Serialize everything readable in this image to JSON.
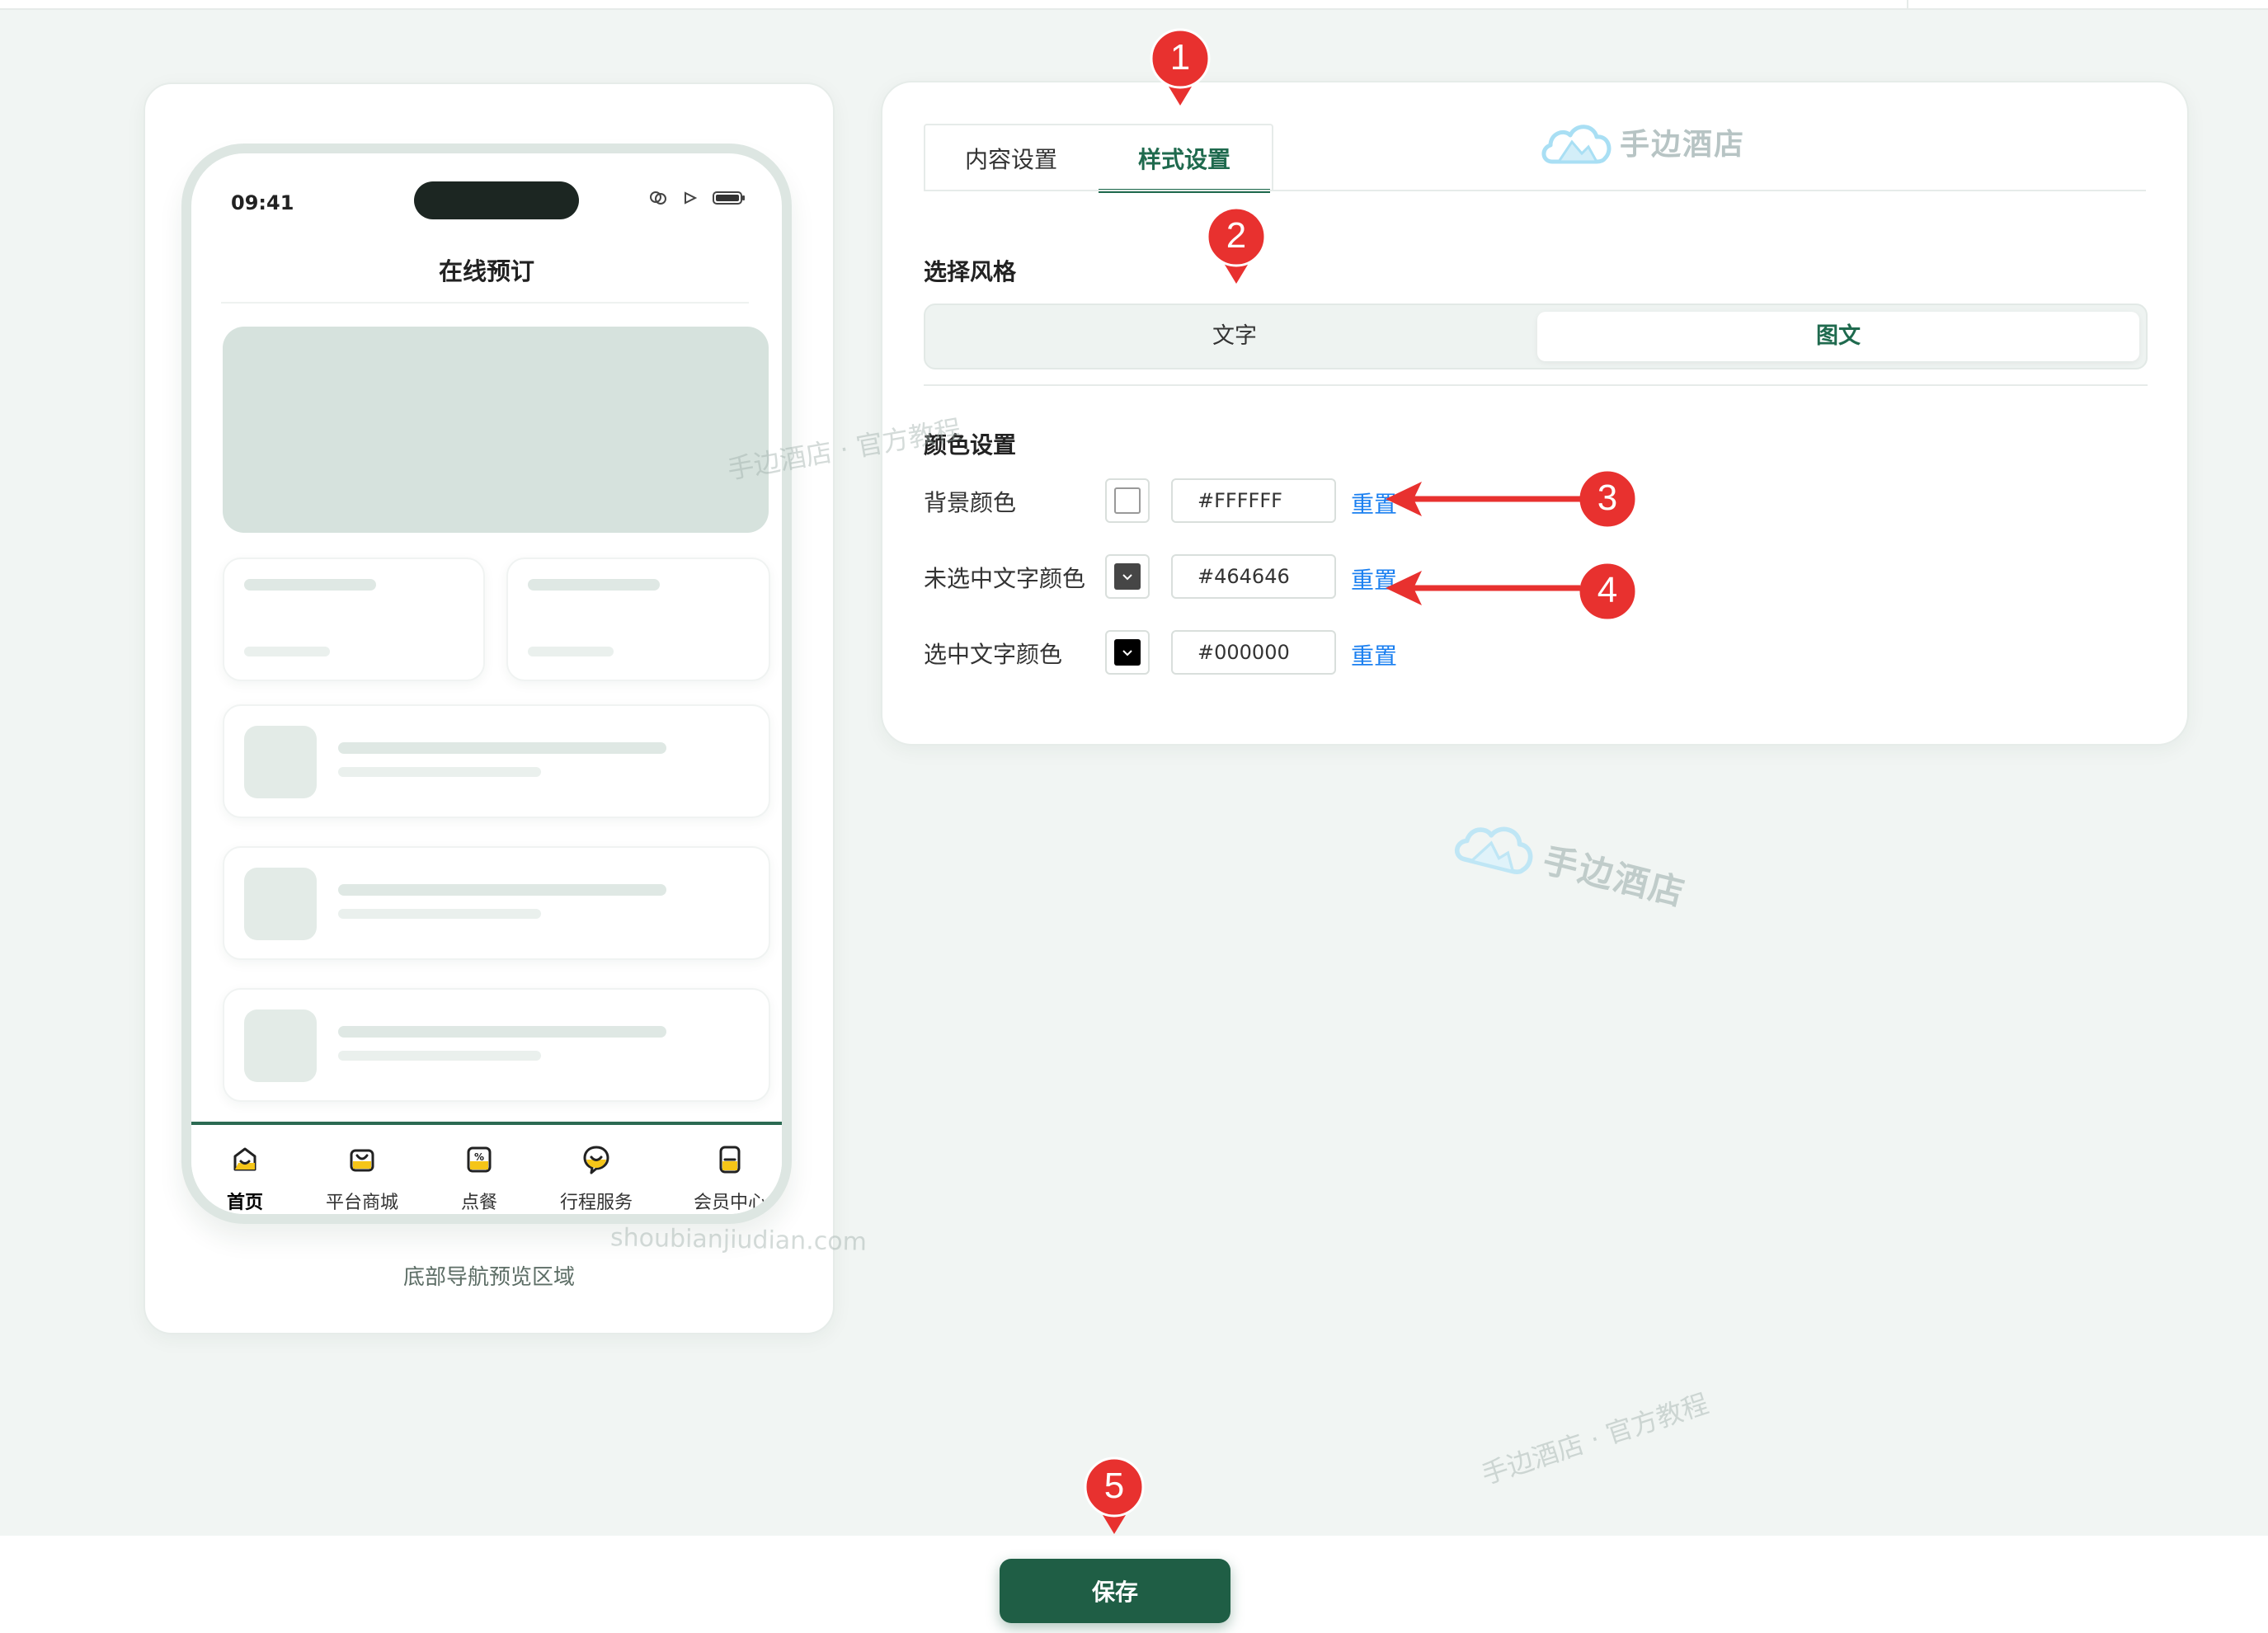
{
  "phone": {
    "time": "09:41",
    "title": "在线预订",
    "tabs": [
      {
        "label": "首页",
        "icon": "home-icon"
      },
      {
        "label": "平台商城",
        "icon": "shop-icon"
      },
      {
        "label": "点餐",
        "icon": "order-food-icon"
      },
      {
        "label": "行程服务",
        "icon": "trip-service-icon"
      },
      {
        "label": "会员中心",
        "icon": "member-icon"
      }
    ]
  },
  "preview": {
    "caption": "底部导航预览区域"
  },
  "settings": {
    "tabs": {
      "content": "内容设置",
      "style": "样式设置"
    },
    "brand": "手边酒店",
    "style_section": {
      "title": "选择风格",
      "options": [
        "文字",
        "图文"
      ],
      "selected": "图文"
    },
    "color_section": {
      "title": "颜色设置",
      "rows": [
        {
          "label": "背景颜色",
          "value": "#FFFFFF",
          "swatch": "#FFFFFF",
          "reset": "重置"
        },
        {
          "label": "未选中文字颜色",
          "value": "#464646",
          "swatch": "#464646",
          "reset": "重置"
        },
        {
          "label": "选中文字颜色",
          "value": "#000000",
          "swatch": "#000000",
          "reset": "重置"
        }
      ]
    }
  },
  "watermarks": {
    "tutorial": "手边酒店 · 官方教程",
    "domain": "shoubianjiudian.com",
    "brand": "手边酒店"
  },
  "footer": {
    "save_label": "保存"
  },
  "annotations": {
    "markers": [
      "1",
      "2",
      "3",
      "4",
      "5"
    ]
  },
  "colors": {
    "accent": "#1f6a4e",
    "link": "#1a7ff0",
    "marker": "#e8312f",
    "tab_icon_yellow": "#f5c518"
  }
}
